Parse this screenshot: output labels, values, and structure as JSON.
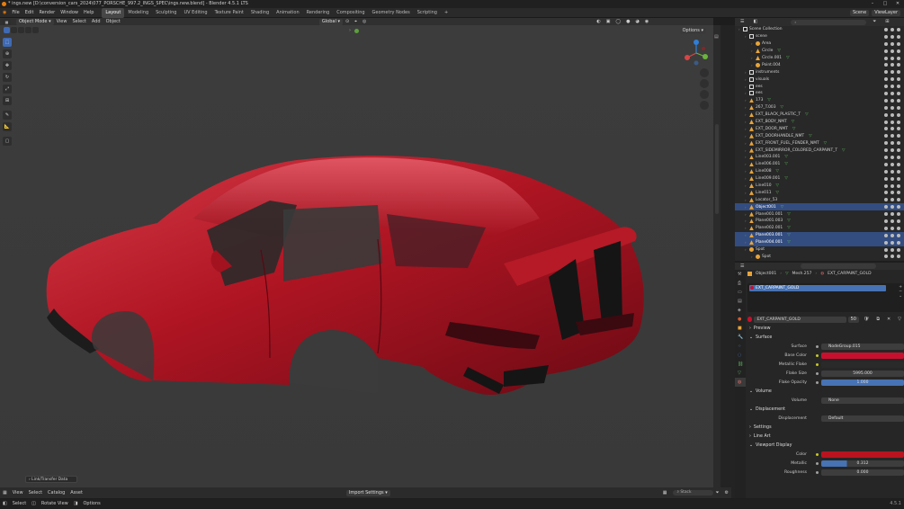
{
  "window": {
    "title": "* ings.new [D:\\conversion_cars_2024\\077_PORSCHE_997.2_INGS_SPEC\\ings.new.blend] - Blender 4.5.1 LTS",
    "controls": [
      "–",
      "□",
      "✕"
    ]
  },
  "menus": [
    "File",
    "Edit",
    "Render",
    "Window",
    "Help"
  ],
  "workspaces": [
    "Layout",
    "Modeling",
    "Sculpting",
    "UV Editing",
    "Texture Paint",
    "Shading",
    "Animation",
    "Rendering",
    "Compositing",
    "Geometry Nodes",
    "Scripting"
  ],
  "active_workspace": "Layout",
  "scene": {
    "name": "Scene",
    "view_layer": "ViewLayer"
  },
  "viewport": {
    "mode": "Object Mode",
    "menus": [
      "View",
      "Select",
      "Add",
      "Object"
    ],
    "transform_orientation": "Global",
    "options_label": "Options",
    "gizmo_axes": {
      "x": "X",
      "y": "Y",
      "z": "Z"
    }
  },
  "outliner": {
    "search_placeholder": "",
    "rows": [
      {
        "label": "Scene Collection",
        "depth": 0,
        "kind": "collection"
      },
      {
        "label": "scene",
        "depth": 1,
        "kind": "collection"
      },
      {
        "label": "Area",
        "depth": 2,
        "kind": "light"
      },
      {
        "label": "Circle",
        "depth": 2,
        "kind": "mesh"
      },
      {
        "label": "Circle.001",
        "depth": 2,
        "kind": "mesh"
      },
      {
        "label": "Point.004",
        "depth": 2,
        "kind": "light"
      },
      {
        "label": "instruments",
        "depth": 1,
        "kind": "collection"
      },
      {
        "label": "visuals",
        "depth": 1,
        "kind": "collection"
      },
      {
        "label": "ees",
        "depth": 1,
        "kind": "collection"
      },
      {
        "label": "ees",
        "depth": 1,
        "kind": "collection"
      },
      {
        "label": "173",
        "depth": 1,
        "kind": "mesh"
      },
      {
        "label": "267_T.003",
        "depth": 1,
        "kind": "mesh"
      },
      {
        "label": "EXT_BLACK_PLASTIC_T",
        "depth": 1,
        "kind": "mesh"
      },
      {
        "label": "EXT_BODY_NMT",
        "depth": 1,
        "kind": "mesh"
      },
      {
        "label": "EXT_DOOR_NMT",
        "depth": 1,
        "kind": "mesh"
      },
      {
        "label": "EXT_DOORHANDLE_NMT",
        "depth": 1,
        "kind": "mesh"
      },
      {
        "label": "EXT_FRONT_FUEL_FENDER_NMT",
        "depth": 1,
        "kind": "mesh"
      },
      {
        "label": "EXT_SIDEMIRROR_COLORED_CARPAINT_T",
        "depth": 1,
        "kind": "mesh"
      },
      {
        "label": "Line003.001",
        "depth": 1,
        "kind": "mesh"
      },
      {
        "label": "Line006.001",
        "depth": 1,
        "kind": "mesh"
      },
      {
        "label": "Line008",
        "depth": 1,
        "kind": "mesh"
      },
      {
        "label": "Line009.001",
        "depth": 1,
        "kind": "mesh"
      },
      {
        "label": "Line010",
        "depth": 1,
        "kind": "mesh"
      },
      {
        "label": "Line011",
        "depth": 1,
        "kind": "mesh"
      },
      {
        "label": "Locator_53",
        "depth": 1,
        "kind": "empty"
      },
      {
        "label": "Object001",
        "depth": 1,
        "kind": "mesh",
        "selected": true
      },
      {
        "label": "Plane001.001",
        "depth": 1,
        "kind": "mesh"
      },
      {
        "label": "Plane001.003",
        "depth": 1,
        "kind": "mesh"
      },
      {
        "label": "Plane002.001",
        "depth": 1,
        "kind": "mesh"
      },
      {
        "label": "Plane003.001",
        "depth": 1,
        "kind": "mesh",
        "selected": true
      },
      {
        "label": "Plane004.001",
        "depth": 1,
        "kind": "mesh",
        "selected": true
      },
      {
        "label": "Spot",
        "depth": 1,
        "kind": "light"
      },
      {
        "label": "Spot",
        "depth": 2,
        "kind": "light"
      }
    ]
  },
  "properties": {
    "breadcrumb": [
      "Object001",
      "Mesh.257",
      "EXT_CARPAINT_GOLD"
    ],
    "slot_name": "EXT_CARPAINT_GOLD",
    "material_name": "EXT_CARPAINT_GOLD",
    "user_count": "50",
    "sections": {
      "preview": "Preview",
      "surface": "Surface",
      "volume": "Volume",
      "displacement": "Displacement",
      "settings": "Settings",
      "line_art": "Line Art",
      "viewport_display": "Viewport Display"
    },
    "surface_fields": [
      {
        "label": "Surface",
        "value": "NodeGroup.015",
        "kind": "text"
      },
      {
        "label": "Base Color",
        "value": "",
        "kind": "color",
        "color": "#c8102e"
      },
      {
        "label": "Metallic Flake",
        "value": "",
        "kind": "color",
        "color": "#2a2a2a"
      },
      {
        "label": "Flake Size",
        "value": "5995.000",
        "kind": "number"
      },
      {
        "label": "Flake Opacity",
        "value": "1.000",
        "kind": "slider",
        "fraction": 1.0
      }
    ],
    "volume_field": {
      "label": "Volume",
      "value": "None"
    },
    "displacement_field": {
      "label": "Displacement",
      "value": "Default"
    },
    "viewport_display_fields": [
      {
        "label": "Color",
        "value": "",
        "kind": "color",
        "color": "#b8141f"
      },
      {
        "label": "Metallic",
        "value": "0.312",
        "kind": "slider",
        "fraction": 0.312
      },
      {
        "label": "Roughness",
        "value": "0.000",
        "kind": "number"
      }
    ]
  },
  "timeline": {
    "menus": [
      "View",
      "Select",
      "Catalog",
      "Asset"
    ],
    "import_settings": "Import Settings",
    "stack_placeholder": "Stack"
  },
  "link_box": "Link/Transfer Data",
  "statusbar": {
    "items": [
      "Select",
      "Rotate View",
      "Options"
    ],
    "version": "4.5.1"
  },
  "colors": {
    "accent": "#4772b3",
    "selection": "#334d80",
    "car_paint": "#b8141f"
  }
}
